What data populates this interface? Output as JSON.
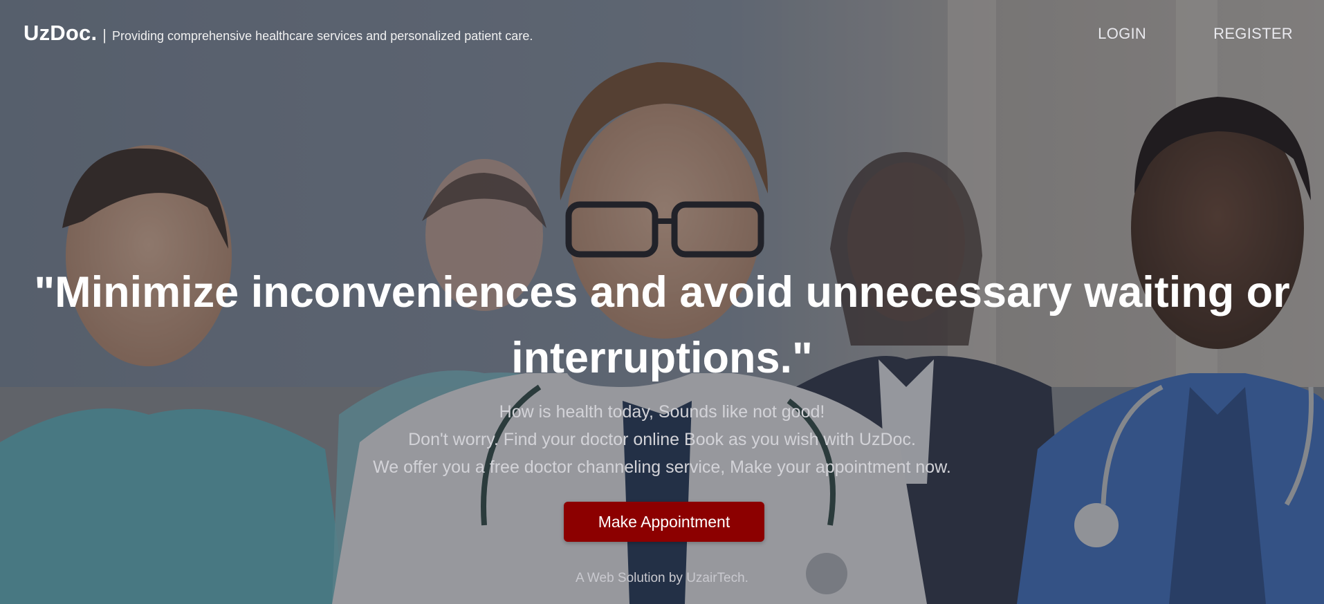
{
  "brand": {
    "logo": "UzDoc.",
    "separator": "|",
    "tagline": "Providing comprehensive healthcare services and personalized patient care."
  },
  "nav": {
    "login": "LOGIN",
    "register": "REGISTER"
  },
  "hero": {
    "headline_line1": "\"Minimize inconveniences and avoid unnecessary waiting or",
    "headline_line2": "interruptions.\"",
    "sub_lines": [
      "How is health today, Sounds like not good!",
      "Don't worry. Find your doctor online Book as you wish with UzDoc.",
      "We offer you a free doctor channeling service, Make your appointment now."
    ],
    "cta_label": "Make Appointment",
    "credit": "A Web Solution by UzairTech."
  },
  "colors": {
    "cta_background": "#8c0000",
    "text_primary": "#ffffff"
  }
}
